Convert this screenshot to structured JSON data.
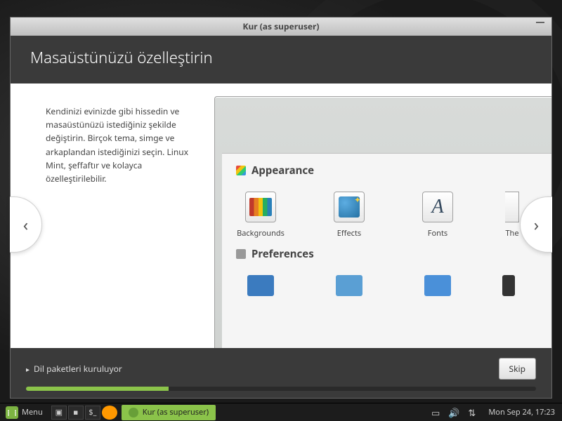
{
  "window": {
    "title": "Kur (as superuser)"
  },
  "header": {
    "title": "Masaüstünüzü özelleştirin"
  },
  "slide": {
    "body_text": "Kendinizi evinizde gibi hissedin ve masaüstünüzü istediğiniz şekilde değiştirin. Birçok tema, simge ve arkaplandan istediğinizi seçin. Linux Mint, şeffaftır ve kolayca özelleştirilebilir."
  },
  "preview": {
    "sections": {
      "appearance_label": "Appearance",
      "preferences_label": "Preferences"
    },
    "items": {
      "backgrounds": "Backgrounds",
      "effects": "Effects",
      "fonts": "Fonts",
      "themes_partial": "The"
    }
  },
  "nav": {
    "prev": "‹",
    "next": "›"
  },
  "footer": {
    "status": "Dil paketleri kuruluyor",
    "skip_label": "Skip",
    "progress_percent": 28
  },
  "panel": {
    "menu_label": "Menu",
    "task_title": "Kur (as superuser)",
    "clock": "Mon Sep 24, 17:23"
  }
}
